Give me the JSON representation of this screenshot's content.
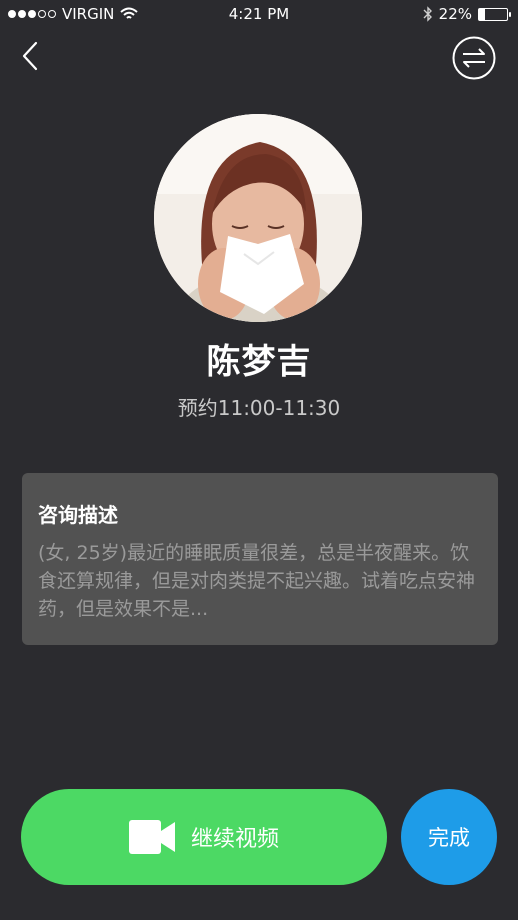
{
  "status_bar": {
    "carrier": "VIRGIN",
    "time": "4:21 PM",
    "battery_percent": "22%",
    "battery_level": 0.22,
    "signal_bars_filled": 3,
    "signal_bars_total": 5,
    "icons": [
      "wifi-icon",
      "bluetooth-icon",
      "battery-icon"
    ]
  },
  "nav": {
    "back_icon": "chevron-left-icon",
    "switch_icon": "swap-arrows-icon"
  },
  "profile": {
    "name": "陈梦吉",
    "appointment": "预约11:00-11:30"
  },
  "description": {
    "title": "咨询描述",
    "text": "(女, 25岁)最近的睡眠质量很差，总是半夜醒来。饮食还算规律，但是对肉类提不起兴趣。试着吃点安神药，但是效果不是..."
  },
  "actions": {
    "continue_video_label": "继续视频",
    "continue_icon": "video-camera-icon",
    "done_label": "完成"
  },
  "colors": {
    "background": "#2b2b2f",
    "card": "#525252",
    "continue_button": "#4cd964",
    "done_button": "#1e9ce8"
  }
}
